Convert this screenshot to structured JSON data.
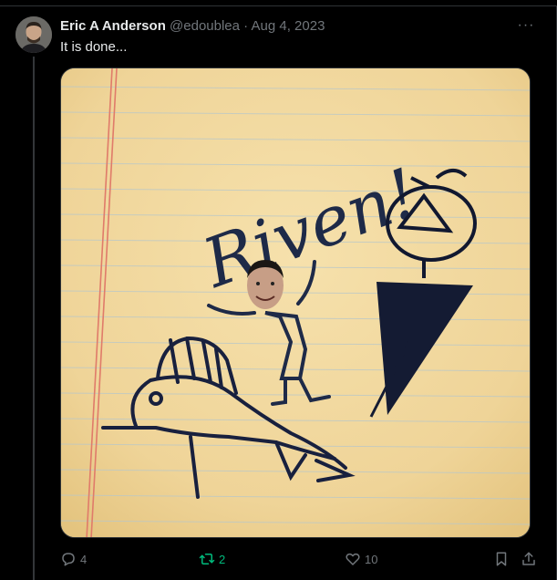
{
  "tweet": {
    "author_name": "Eric A Anderson",
    "handle": "@edoublea",
    "separator": "·",
    "date": "Aug 4, 2023",
    "text": "It is done...",
    "more_label": "···"
  },
  "media": {
    "handwritten_word": "Riven!"
  },
  "actions": {
    "reply_count": "4",
    "retweet_count": "2",
    "like_count": "10"
  },
  "colors": {
    "background": "#000000",
    "retweet_active": "#00ba7c",
    "muted": "#71767b",
    "paper": "#f1d9a0",
    "ink": "#1e2a48"
  },
  "icons": [
    "avatar",
    "more-icon",
    "reply-icon",
    "retweet-icon",
    "like-icon",
    "bookmark-icon",
    "share-icon"
  ]
}
